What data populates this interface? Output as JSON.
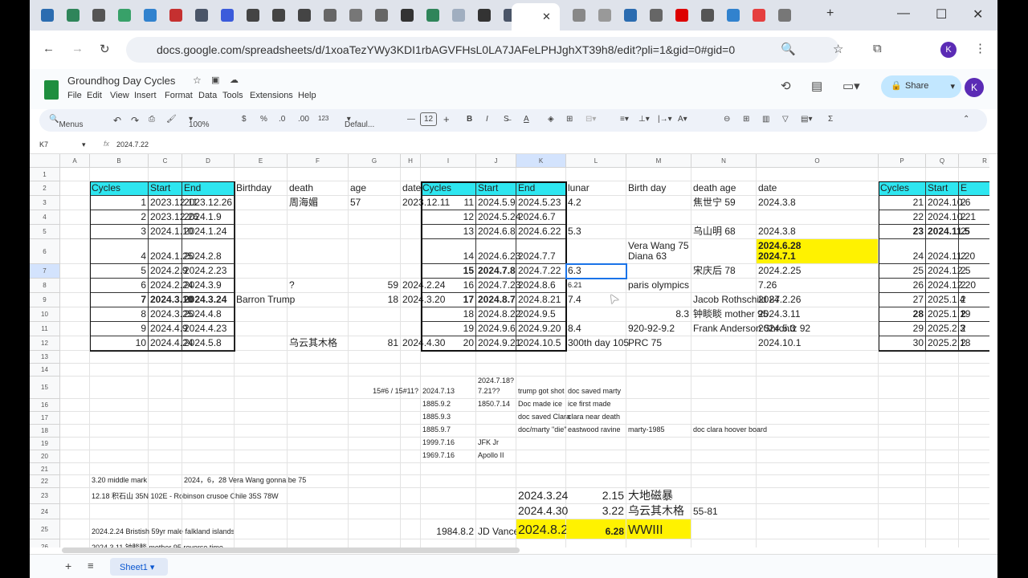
{
  "browser": {
    "url": "docs.google.com/spreadsheets/d/1xoaTezYWy3KDI1rbAGVFHsL0LA7JAFeLPHJghXT39h8/edit?pli=1&gid=0#gid=0",
    "profile_initial": "K",
    "tab_count": 29,
    "active_tab_index": 19
  },
  "doc": {
    "title": "Groundhog Day Cycles",
    "menus": [
      "File",
      "Edit",
      "View",
      "Insert",
      "Format",
      "Data",
      "Tools",
      "Extensions",
      "Help"
    ],
    "share_label": "Share",
    "avatar": "K"
  },
  "toolbar": {
    "search": "Menus",
    "zoom": "100%",
    "currency": "$",
    "percent": "%",
    "dec_less": ".0",
    "dec_more": ".00",
    "format_123": "123",
    "font": "Defaul...",
    "font_size": "12",
    "bold": "B",
    "italic": "I",
    "sigma": "Σ"
  },
  "formula_bar": {
    "cell_ref": "K7",
    "value": "2024.7.22"
  },
  "sheet": {
    "columns": [
      "A",
      "B",
      "C",
      "D",
      "E",
      "F",
      "G",
      "H",
      "I",
      "J",
      "K",
      "L",
      "M",
      "N",
      "O",
      "P",
      "Q",
      "R"
    ],
    "rows": 26,
    "selected": "K7",
    "tabs": [
      "Sheet1"
    ],
    "cells": [
      {
        "ref": "B2",
        "v": "Cycles",
        "f": "hdr"
      },
      {
        "ref": "C2",
        "v": "Start",
        "f": "hdr"
      },
      {
        "ref": "D2",
        "v": "End",
        "f": "hdr"
      },
      {
        "ref": "E2",
        "v": "Birthday"
      },
      {
        "ref": "F2",
        "v": "death"
      },
      {
        "ref": "G2",
        "v": "age"
      },
      {
        "ref": "H2",
        "v": "date"
      },
      {
        "ref": "I2",
        "v": "Cycles",
        "f": "hdr"
      },
      {
        "ref": "J2",
        "v": "Start",
        "f": "hdr"
      },
      {
        "ref": "K2",
        "v": "End",
        "f": "hdr"
      },
      {
        "ref": "L2",
        "v": "lunar"
      },
      {
        "ref": "M2",
        "v": "Birth day"
      },
      {
        "ref": "N2",
        "v": "death age"
      },
      {
        "ref": "O2",
        "v": "date"
      },
      {
        "ref": "P2",
        "v": "Cycles",
        "f": "hdr"
      },
      {
        "ref": "Q2",
        "v": "Start",
        "f": "hdr"
      },
      {
        "ref": "R2",
        "v": "E",
        "f": "hdr"
      },
      {
        "ref": "B3",
        "v": "1",
        "f": "r"
      },
      {
        "ref": "C3",
        "v": "2023.12.11"
      },
      {
        "ref": "D3",
        "v": "2023.12.26"
      },
      {
        "ref": "F3",
        "v": "周海媚"
      },
      {
        "ref": "G3",
        "v": "57"
      },
      {
        "ref": "H3",
        "v": "2023.12.11"
      },
      {
        "ref": "I3",
        "v": "11",
        "f": "r"
      },
      {
        "ref": "J3",
        "v": "2024.5.9"
      },
      {
        "ref": "K3",
        "v": "2024.5.23"
      },
      {
        "ref": "L3",
        "v": "4.2"
      },
      {
        "ref": "N3",
        "v": "焦世宁 59"
      },
      {
        "ref": "O3",
        "v": "2024.3.8"
      },
      {
        "ref": "P3",
        "v": "21",
        "f": "r"
      },
      {
        "ref": "Q3",
        "v": "2024.10.6"
      },
      {
        "ref": "R3",
        "v": "2"
      },
      {
        "ref": "B4",
        "v": "2",
        "f": "r"
      },
      {
        "ref": "C4",
        "v": "2023.12.26"
      },
      {
        "ref": "D4",
        "v": "2024.1.9"
      },
      {
        "ref": "I4",
        "v": "12",
        "f": "r"
      },
      {
        "ref": "J4",
        "v": "2024.5.24"
      },
      {
        "ref": "K4",
        "v": "2024.6.7"
      },
      {
        "ref": "P4",
        "v": "22",
        "f": "r"
      },
      {
        "ref": "Q4",
        "v": "2024.10.21"
      },
      {
        "ref": "R4",
        "v": "2"
      },
      {
        "ref": "B5",
        "v": "3",
        "f": "r"
      },
      {
        "ref": "C5",
        "v": "2024.1.10"
      },
      {
        "ref": "D5",
        "v": "2024.1.24"
      },
      {
        "ref": "I5",
        "v": "13",
        "f": "r"
      },
      {
        "ref": "J5",
        "v": "2024.6.8"
      },
      {
        "ref": "K5",
        "v": "2024.6.22"
      },
      {
        "ref": "L5",
        "v": "5.3"
      },
      {
        "ref": "N5",
        "v": "乌山明 68"
      },
      {
        "ref": "O5",
        "v": "2024.3.8"
      },
      {
        "ref": "P5",
        "v": "23",
        "f": "r b"
      },
      {
        "ref": "Q5",
        "v": "2024.11.5",
        "f": "b"
      },
      {
        "ref": "R5",
        "v": "2"
      },
      {
        "ref": "B6",
        "v": "4",
        "f": "r"
      },
      {
        "ref": "C6",
        "v": "2024.1.25"
      },
      {
        "ref": "D6",
        "v": "2024.2.8"
      },
      {
        "ref": "I6",
        "v": "14",
        "f": "r"
      },
      {
        "ref": "J6",
        "v": "2024.6.23"
      },
      {
        "ref": "K6",
        "v": "2024.7.7"
      },
      {
        "ref": "M6",
        "v": "Vera Wang 75\nDiana 63"
      },
      {
        "ref": "O6",
        "v": "2024.6.28\n2024.7.1",
        "f": "b yel"
      },
      {
        "ref": "P6",
        "v": "24",
        "f": "r"
      },
      {
        "ref": "Q6",
        "v": "2024.11.20"
      },
      {
        "ref": "R6",
        "v": "2"
      },
      {
        "ref": "B7",
        "v": "5",
        "f": "r"
      },
      {
        "ref": "C7",
        "v": "2024.2.9"
      },
      {
        "ref": "D7",
        "v": "2024.2.23"
      },
      {
        "ref": "I7",
        "v": "15",
        "f": "r b"
      },
      {
        "ref": "J7",
        "v": "2024.7.8",
        "f": "b"
      },
      {
        "ref": "K7",
        "v": "2024.7.22"
      },
      {
        "ref": "L7",
        "v": "6.3"
      },
      {
        "ref": "N7",
        "v": "宋庆后 78"
      },
      {
        "ref": "O7",
        "v": "2024.2.25"
      },
      {
        "ref": "P7",
        "v": "25",
        "f": "r"
      },
      {
        "ref": "Q7",
        "v": "2024.12.5"
      },
      {
        "ref": "R7",
        "v": "2"
      },
      {
        "ref": "B8",
        "v": "6",
        "f": "r"
      },
      {
        "ref": "C8",
        "v": "2024.2.24"
      },
      {
        "ref": "D8",
        "v": "2024.3.9"
      },
      {
        "ref": "F8",
        "v": "?"
      },
      {
        "ref": "G8",
        "v": "59",
        "f": "r"
      },
      {
        "ref": "H8",
        "v": "2024.2.24"
      },
      {
        "ref": "I8",
        "v": "16",
        "f": "r"
      },
      {
        "ref": "J8",
        "v": "2024.7.23"
      },
      {
        "ref": "K8",
        "v": "2024.8.6"
      },
      {
        "ref": "L8",
        "v": "6.21",
        "f": "sm"
      },
      {
        "ref": "M8",
        "v": "paris olympics"
      },
      {
        "ref": "O8",
        "v": "7.26"
      },
      {
        "ref": "P8",
        "v": "26",
        "f": "r"
      },
      {
        "ref": "Q8",
        "v": "2024.12.20"
      },
      {
        "ref": "R8",
        "v": "2"
      },
      {
        "ref": "B9",
        "v": "7",
        "f": "r b"
      },
      {
        "ref": "C9",
        "v": "2024.3.10",
        "f": "b"
      },
      {
        "ref": "D9",
        "v": "2024.3.24",
        "f": "b"
      },
      {
        "ref": "E9",
        "v": "Barron Trump"
      },
      {
        "ref": "G9",
        "v": "18",
        "f": "r"
      },
      {
        "ref": "H9",
        "v": "2024.3.20"
      },
      {
        "ref": "I9",
        "v": "17",
        "f": "r b"
      },
      {
        "ref": "J9",
        "v": "2024.8.7",
        "f": "b"
      },
      {
        "ref": "K9",
        "v": "2024.8.21"
      },
      {
        "ref": "L9",
        "v": "7.4"
      },
      {
        "ref": "N9",
        "v": "Jacob Rothschild 87"
      },
      {
        "ref": "O9",
        "v": "2024.2.26"
      },
      {
        "ref": "P9",
        "v": "27",
        "f": "r"
      },
      {
        "ref": "Q9",
        "v": "2025.1.4"
      },
      {
        "ref": "R9",
        "v": "2"
      },
      {
        "ref": "B10",
        "v": "8",
        "f": "r"
      },
      {
        "ref": "C10",
        "v": "2024.3.25"
      },
      {
        "ref": "D10",
        "v": "2024.4.8"
      },
      {
        "ref": "I10",
        "v": "18",
        "f": "r"
      },
      {
        "ref": "J10",
        "v": "2024.8.22"
      },
      {
        "ref": "K10",
        "v": "2024.9.5"
      },
      {
        "ref": "M10",
        "v": "8.3",
        "f": "r"
      },
      {
        "ref": "N10",
        "v": "钟睒睒 mother 95"
      },
      {
        "ref": "O10",
        "v": "2024.3.11"
      },
      {
        "ref": "P10",
        "v": "28",
        "f": "r b"
      },
      {
        "ref": "Q10",
        "v": "2025.1.19"
      },
      {
        "ref": "R10",
        "v": "2",
        "f": "b"
      },
      {
        "ref": "B11",
        "v": "9",
        "f": "r"
      },
      {
        "ref": "C11",
        "v": "2024.4.9"
      },
      {
        "ref": "D11",
        "v": "2024.4.23"
      },
      {
        "ref": "I11",
        "v": "19",
        "f": "r"
      },
      {
        "ref": "J11",
        "v": "2024.9.6"
      },
      {
        "ref": "K11",
        "v": "2024.9.20"
      },
      {
        "ref": "L11",
        "v": "8.4"
      },
      {
        "ref": "M11",
        "v": "920-92-9.2"
      },
      {
        "ref": "N11",
        "v": "Frank Anderson Shrontz 92"
      },
      {
        "ref": "O11",
        "v": "2024.5.3"
      },
      {
        "ref": "P11",
        "v": "29",
        "f": "r"
      },
      {
        "ref": "Q11",
        "v": "2025.2.3"
      },
      {
        "ref": "R11",
        "v": "2"
      },
      {
        "ref": "B12",
        "v": "10",
        "f": "r"
      },
      {
        "ref": "C12",
        "v": "2024.4.24"
      },
      {
        "ref": "D12",
        "v": "2024.5.8"
      },
      {
        "ref": "F12",
        "v": "乌云其木格"
      },
      {
        "ref": "G12",
        "v": "81",
        "f": "r"
      },
      {
        "ref": "H12",
        "v": "2024.4.30"
      },
      {
        "ref": "I12",
        "v": "20",
        "f": "r"
      },
      {
        "ref": "J12",
        "v": "2024.9.21"
      },
      {
        "ref": "K12",
        "v": "2024.10.5"
      },
      {
        "ref": "L12",
        "v": "300th day 105"
      },
      {
        "ref": "M12",
        "v": "PRC 75"
      },
      {
        "ref": "O12",
        "v": "2024.10.1"
      },
      {
        "ref": "P12",
        "v": "30",
        "f": "r"
      },
      {
        "ref": "Q12",
        "v": "2025.2.18"
      },
      {
        "ref": "R12",
        "v": "2"
      },
      {
        "ref": "H15",
        "v": "15#6 / 15#11?",
        "f": "sm r"
      },
      {
        "ref": "I15",
        "v": "2024.7.13",
        "f": "sm"
      },
      {
        "ref": "J15",
        "v": "2024.7.18?\n7.21??",
        "f": "sm"
      },
      {
        "ref": "K15",
        "v": "trump got shot",
        "f": "sm"
      },
      {
        "ref": "L15",
        "v": "doc saved marty",
        "f": "sm"
      },
      {
        "ref": "I16",
        "v": "1885.9.2",
        "f": "sm"
      },
      {
        "ref": "J16",
        "v": "1850.7.14",
        "f": "sm"
      },
      {
        "ref": "K16",
        "v": "Doc made ice",
        "f": "sm"
      },
      {
        "ref": "L16",
        "v": "ice first made",
        "f": "sm"
      },
      {
        "ref": "I17",
        "v": "1885.9.3",
        "f": "sm"
      },
      {
        "ref": "K17",
        "v": "doc saved Clara",
        "f": "sm"
      },
      {
        "ref": "L17",
        "v": "clara near death",
        "f": "sm"
      },
      {
        "ref": "I18",
        "v": "1885.9.7",
        "f": "sm"
      },
      {
        "ref": "K18",
        "v": "doc/marty \"die\"",
        "f": "sm"
      },
      {
        "ref": "L18",
        "v": "eastwood ravine",
        "f": "sm"
      },
      {
        "ref": "M18",
        "v": "marty-1985",
        "f": "sm"
      },
      {
        "ref": "N18",
        "v": "doc clara hoover board",
        "f": "sm"
      },
      {
        "ref": "I19",
        "v": "1999.7.16",
        "f": "sm"
      },
      {
        "ref": "J19",
        "v": "JFK Jr",
        "f": "sm"
      },
      {
        "ref": "I20",
        "v": "1969.7.16",
        "f": "sm"
      },
      {
        "ref": "J20",
        "v": "Apollo II",
        "f": "sm"
      },
      {
        "ref": "B22",
        "v": "3.20 middle mark",
        "f": "sm"
      },
      {
        "ref": "D22",
        "v": "2024，6，28 Vera Wang gonna be 75",
        "f": "sm"
      },
      {
        "ref": "B23",
        "v": "12.18 积石山 35N 102E - Robinson crusoe Chile 35S 78W",
        "f": "sm"
      },
      {
        "ref": "K23",
        "v": "2024.3.24",
        "f": "lg"
      },
      {
        "ref": "L23",
        "v": "2.15",
        "f": "lg r"
      },
      {
        "ref": "M23",
        "v": "大地磁暴",
        "f": "lg"
      },
      {
        "ref": "K24",
        "v": "2024.4.30",
        "f": "lg"
      },
      {
        "ref": "L24",
        "v": "3.22",
        "f": "lg r"
      },
      {
        "ref": "M24",
        "v": "乌云其木格",
        "f": "lg"
      },
      {
        "ref": "N24",
        "v": "55-81"
      },
      {
        "ref": "B25",
        "v": "2024.2.24 Bristish 59yr male falkland islands",
        "f": "sm"
      },
      {
        "ref": "I25",
        "v": "1984.8.2",
        "f": "r"
      },
      {
        "ref": "J25",
        "v": "JD Vance"
      },
      {
        "ref": "K25",
        "v": "2024.8.2",
        "f": "xl yel"
      },
      {
        "ref": "L25",
        "v": "6.28",
        "f": "b r yel"
      },
      {
        "ref": "M25",
        "v": "WWIII",
        "f": "xl yel"
      },
      {
        "ref": "B26",
        "v": "2024.3.11 钟睒睒 mother 95 reverse time",
        "f": "sm"
      }
    ]
  }
}
